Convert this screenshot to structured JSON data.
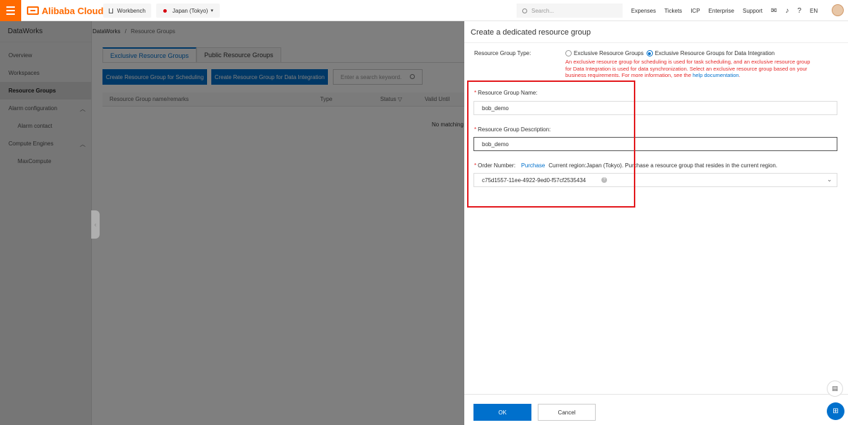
{
  "topbar": {
    "brand": "Alibaba Cloud",
    "workbench": "Workbench",
    "region": "Japan (Tokyo)",
    "search_placeholder": "Search...",
    "links": [
      "Expenses",
      "Tickets",
      "ICP",
      "Enterprise",
      "Support"
    ],
    "lang": "EN"
  },
  "sidebar": {
    "title": "DataWorks",
    "items": [
      {
        "label": "Overview"
      },
      {
        "label": "Workspaces"
      },
      {
        "label": "Resource Groups"
      },
      {
        "label": "Alarm configuration"
      },
      {
        "label": "Alarm contact"
      },
      {
        "label": "Compute Engines"
      },
      {
        "label": "MaxCompute"
      }
    ]
  },
  "main": {
    "breadcrumb_root": "DataWorks",
    "breadcrumb_sep": "/",
    "breadcrumb_current": "Resource Groups",
    "tabs": [
      {
        "label": "Exclusive Resource Groups"
      },
      {
        "label": "Public Resource Groups"
      }
    ],
    "btn_sched": "Create Resource Group for Scheduling",
    "btn_di": "Create Resource Group for Data Integration",
    "search_placeholder": "Enter a search keyword.",
    "columns": [
      "Resource Group name/remarks",
      "Type",
      "Status",
      "Valid Until"
    ],
    "empty": "No matching"
  },
  "panel": {
    "title": "Create a dedicated resource group",
    "type_label": "Resource Group Type:",
    "type_options": [
      "Exclusive Resource Groups",
      "Exclusive Resource Groups for Data Integration"
    ],
    "warning": "An exclusive resource group for scheduling is used for task scheduling, and an exclusive resource group for Data Integration is used for data synchronization. Select an exclusive resource group based on your business requirements. For more information, see the",
    "warning_link": "help documentation",
    "warning_end": ".",
    "name_label": "Resource Group Name:",
    "name_value": "bob_demo",
    "desc_label": "Resource Group Description:",
    "desc_value": "bob_demo",
    "order_label": "Order Number:",
    "order_link": "Purchase",
    "order_hint": "Current region:Japan (Tokyo). Purchase a resource group that resides in the current region.",
    "order_value": "c75d1557-11ee-4922-9ed0-f57cf2535434",
    "ok": "OK",
    "cancel": "Cancel"
  }
}
